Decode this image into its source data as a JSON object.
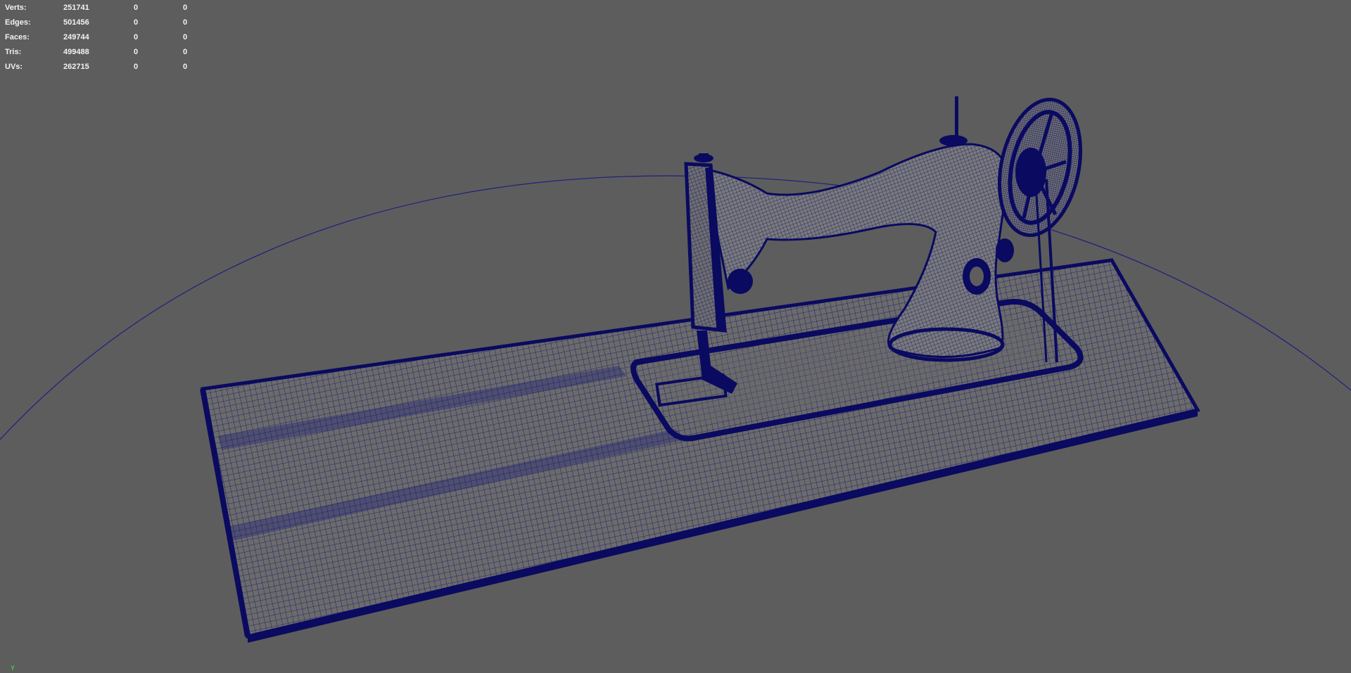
{
  "colors": {
    "background": "#5d5d5d",
    "wire": "#0d0d6b",
    "hud_text": "#f2f2f2",
    "axis_y": "#33d433"
  },
  "hud": {
    "rows": [
      {
        "label": "Verts:",
        "total": "251741",
        "selected": "0",
        "object": "0"
      },
      {
        "label": "Edges:",
        "total": "501456",
        "selected": "0",
        "object": "0"
      },
      {
        "label": "Faces:",
        "total": "249744",
        "selected": "0",
        "object": "0"
      },
      {
        "label": "Tris:",
        "total": "499488",
        "selected": "0",
        "object": "0"
      },
      {
        "label": "UVs:",
        "total": "262715",
        "selected": "0",
        "object": "0"
      }
    ]
  },
  "axis_gizmo": {
    "label": "Y"
  },
  "scene": {
    "object": "sewing-machine-wireframe",
    "shading": "wireframe-on-shaded"
  }
}
